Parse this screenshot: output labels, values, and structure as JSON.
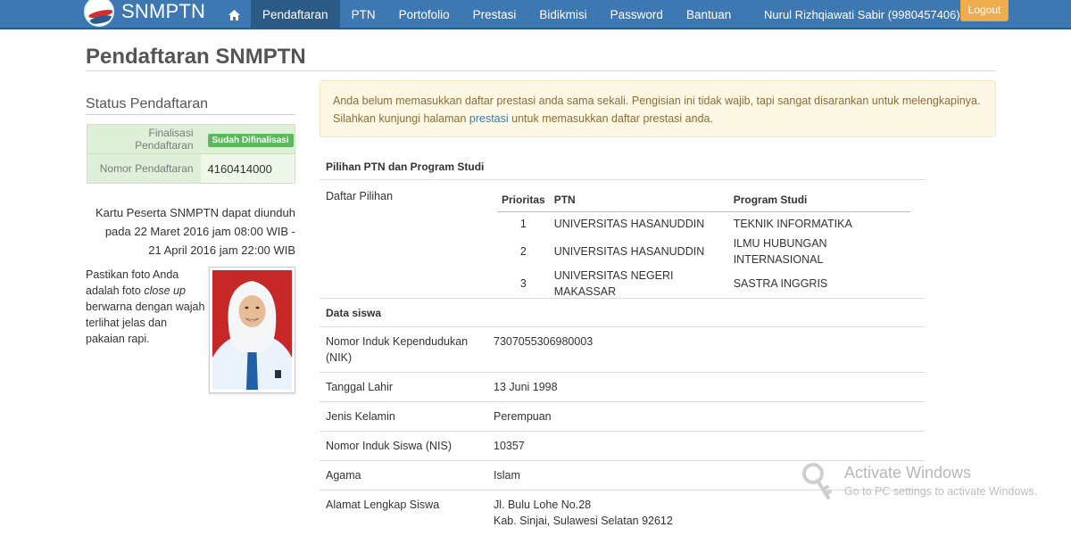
{
  "navbar": {
    "brand": "SNMPTN",
    "home_icon": "home-icon",
    "items": [
      {
        "label": "Pendaftaran",
        "active": true
      },
      {
        "label": "PTN",
        "active": false
      },
      {
        "label": "Portofolio",
        "active": false
      },
      {
        "label": "Prestasi",
        "active": false
      },
      {
        "label": "Bidikmisi",
        "active": false
      },
      {
        "label": "Password",
        "active": false
      },
      {
        "label": "Bantuan",
        "active": false
      }
    ],
    "user": "Nurul Rizhqiawati Sabir (9980457406)",
    "logout_label": "Logout"
  },
  "page": {
    "title": "Pendaftaran SNMPTN"
  },
  "status": {
    "heading": "Status Pendaftaran",
    "finalisasi_label": "Finalisasi Pendaftaran",
    "finalisasi_value": "Sudah Difinalisasi",
    "nomor_label": "Nomor Pendaftaran",
    "nomor_value": "4160414000"
  },
  "kartu_note": "Kartu Peserta SNMPTN dapat diunduh pada 22 Maret 2016 jam 08:00 WIB - 21 April 2016 jam 22:00 WIB",
  "foto_note": {
    "before": "Pastikan foto Anda adalah foto ",
    "emph": "close up",
    "after": " berwarna dengan wajah terlihat jelas dan pakaian rapi."
  },
  "alert": {
    "line1": "Anda belum memasukkan daftar prestasi anda sama sekali. Pengisian ini tidak wajib, tapi sangat disarankan untuk melengkapinya.",
    "line2_before": "Silahkan kunjungi halaman ",
    "link": "prestasi",
    "line2_after": " untuk memasukkan daftar prestasi anda."
  },
  "pilihan": {
    "section_title": "Pilihan PTN dan Program Studi",
    "label": "Daftar Pilihan",
    "headers": {
      "prioritas": "Prioritas",
      "ptn": "PTN",
      "prodi": "Program Studi"
    },
    "rows": [
      {
        "no": "1",
        "ptn": "UNIVERSITAS HASANUDDIN",
        "prodi": "TEKNIK INFORMATIKA"
      },
      {
        "no": "2",
        "ptn": "UNIVERSITAS HASANUDDIN",
        "prodi": "ILMU HUBUNGAN INTERNASIONAL"
      },
      {
        "no": "3",
        "ptn": "UNIVERSITAS NEGERI MAKASSAR",
        "prodi": "SASTRA INGGRIS"
      }
    ]
  },
  "siswa": {
    "section_title": "Data siswa",
    "rows": [
      {
        "label": "Nomor Induk Kependudukan (NIK)",
        "value": "7307055306980003"
      },
      {
        "label": "Tanggal Lahir",
        "value": "13 Juni 1998"
      },
      {
        "label": "Jenis Kelamin",
        "value": "Perempuan"
      },
      {
        "label": "Nomor Induk Siswa (NIS)",
        "value": "10357"
      },
      {
        "label": "Agama",
        "value": "Islam"
      },
      {
        "label": "Alamat Lengkap Siswa",
        "value": "Jl. Bulu Lohe No.28",
        "value2": "Kab. Sinjai, Sulawesi Selatan 92612"
      }
    ]
  },
  "watermark": {
    "title": "Activate Windows",
    "subtitle": "Go to PC settings to activate Windows."
  },
  "colors": {
    "navbar": "#3d78b2",
    "nav_active": "#2b5a87",
    "logout": "#f0ad4e",
    "status_bg": "#dff0d8",
    "badge": "#5cb85c",
    "alert_bg": "#fcf8e3",
    "link": "#3d78b2"
  }
}
